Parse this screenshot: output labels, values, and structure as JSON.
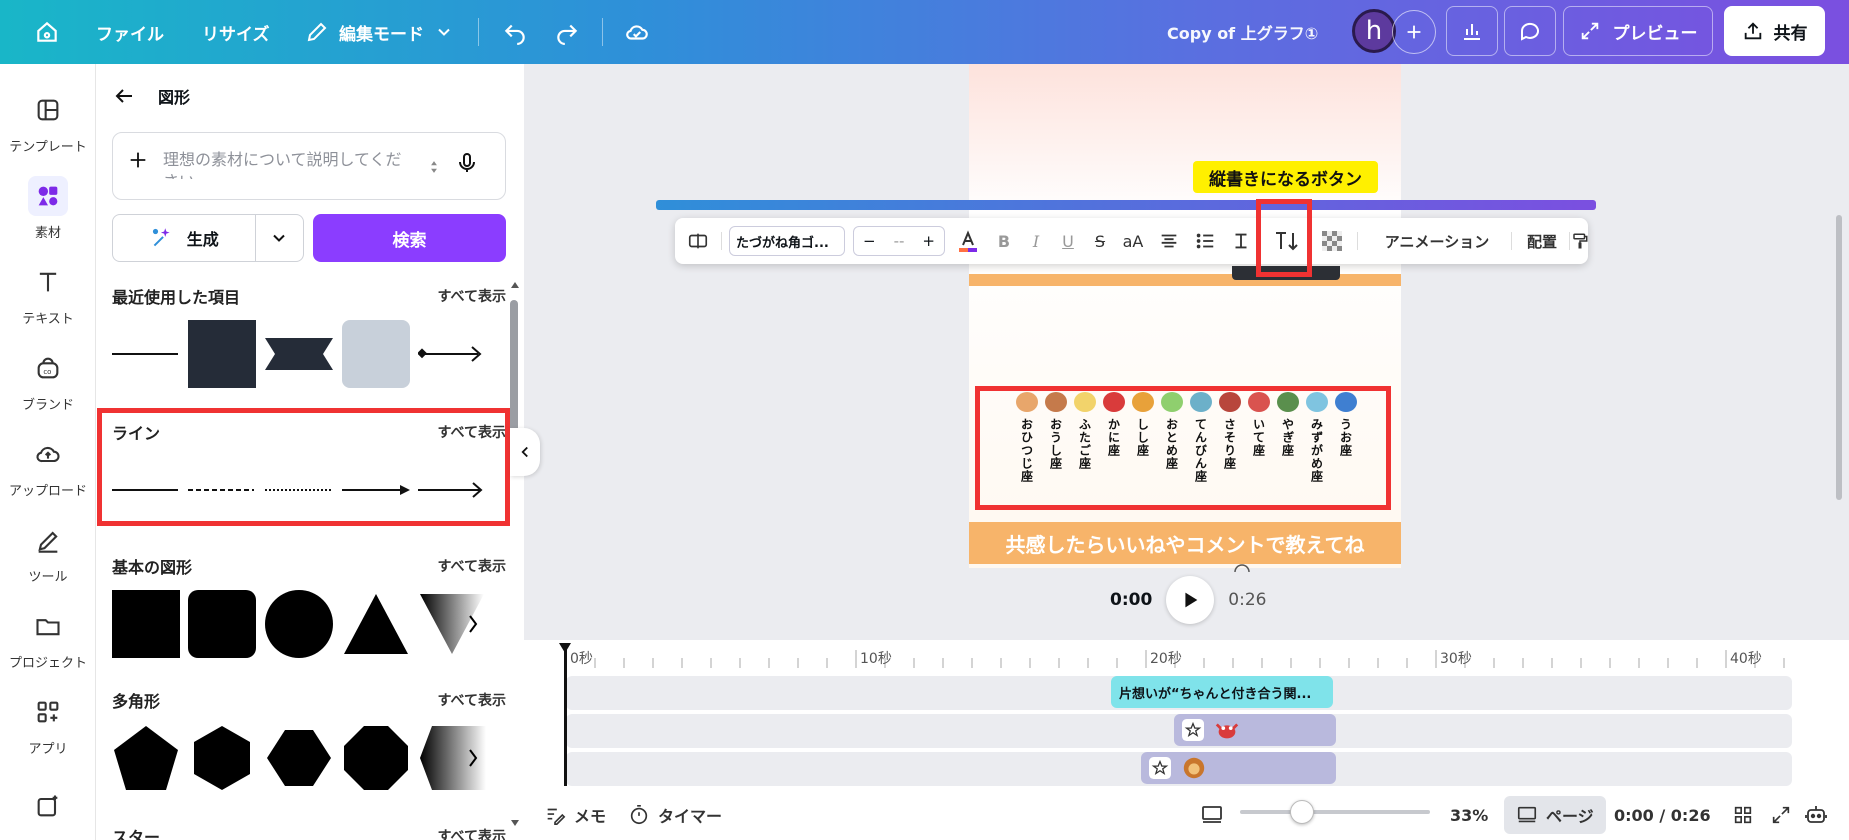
{
  "topbar": {
    "file": "ファイル",
    "resize": "リサイズ",
    "edit_mode": "編集モード",
    "doc_title": "Copy of 上グラフ①",
    "avatar_letter": "h",
    "preview": "プレビュー",
    "share": "共有"
  },
  "rail": {
    "template": "テンプレート",
    "elements": "素材",
    "text": "テキスト",
    "brand": "ブランド",
    "upload": "アップロード",
    "tools": "ツール",
    "projects": "プロジェクト",
    "apps": "アプリ"
  },
  "panel": {
    "title": "図形",
    "search_placeholder": "理想の素材について説明してください",
    "generate": "生成",
    "search": "検索",
    "sections": {
      "recent": {
        "title": "最近使用した項目",
        "all": "すべて表示"
      },
      "lines": {
        "title": "ライン",
        "all": "すべて表示"
      },
      "basic": {
        "title": "基本の図形",
        "all": "すべて表示"
      },
      "polygon": {
        "title": "多角形",
        "all": "すべて表示"
      },
      "star": {
        "title": "スター",
        "all": "すべて表示"
      }
    }
  },
  "toolbar": {
    "font": "たづがね角ゴ...",
    "size_minus": "−",
    "size_value": "--",
    "size_plus": "+",
    "case": "aA",
    "animation": "アニメーション",
    "position": "配置"
  },
  "canvas": {
    "callout": "縦書きになるボタン",
    "banner": "共感したらいいねやコメントで教えてね",
    "signs": [
      {
        "label": "おひつじ座",
        "color": "#e8a66b"
      },
      {
        "label": "おうし座",
        "color": "#c57a4b"
      },
      {
        "label": "ふたご座",
        "color": "#f2d36b"
      },
      {
        "label": "かに座",
        "color": "#d93b3b"
      },
      {
        "label": "しし座",
        "color": "#e8a13a"
      },
      {
        "label": "おとめ座",
        "color": "#8fcf6e"
      },
      {
        "label": "てんびん座",
        "color": "#6cb0c9"
      },
      {
        "label": "さそり座",
        "color": "#b8463c"
      },
      {
        "label": "いて座",
        "color": "#d9534f"
      },
      {
        "label": "やぎ座",
        "color": "#5a8f4d"
      },
      {
        "label": "みずがめ座",
        "color": "#7fc4e0"
      },
      {
        "label": "うお座",
        "color": "#3f7fd1"
      }
    ],
    "current_time": "0:00",
    "duration": "0:26"
  },
  "timeline": {
    "ticks": [
      "0秒",
      "10秒",
      "20秒",
      "30秒",
      "40秒"
    ],
    "clip_text": "片想いが“ちゃんと付き合う関..."
  },
  "bottom": {
    "notes": "メモ",
    "timer": "タイマー",
    "zoom": "33%",
    "page": "ページ",
    "time": "0:00 / 0:26"
  },
  "colors": {
    "accent": "#8b3dff",
    "highlight_red": "#f03232",
    "callout_yellow": "#fff000",
    "banner_orange": "#f7b46a",
    "clip_cyan": "#7fe3ea",
    "clip_lavender": "#b9b9dd"
  }
}
